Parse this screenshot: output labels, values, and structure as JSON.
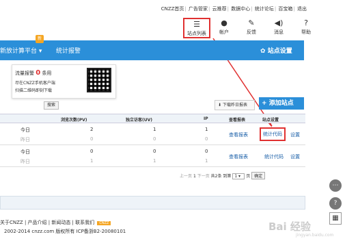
{
  "toplinks": [
    "CNZZ首页",
    "广告管家",
    "云推荐",
    "数据中心",
    "统计论坛",
    "百宝箱",
    "退出"
  ],
  "iconbar": [
    {
      "label": "站点列表",
      "icon": "list-icon"
    },
    {
      "label": "帐户",
      "icon": "user-icon"
    },
    {
      "label": "反馈",
      "icon": "edit-icon"
    },
    {
      "label": "消息",
      "icon": "speaker-icon"
    },
    {
      "label": "帮助",
      "icon": "help-icon"
    }
  ],
  "nav": {
    "platform": "新放计算平台 ▾",
    "report": "统计报警",
    "badge": "新",
    "settings": "站点设置"
  },
  "popup": {
    "line1_prefix": "流量报警",
    "count": "0",
    "line1_suffix": "条用",
    "line2": "尽在CNZZ手机客户端",
    "line3": "扫描二维码即刻下载"
  },
  "toolbar": {
    "search": "搜索",
    "download": "下载昨日报表",
    "add": "添加站点"
  },
  "table": {
    "headers": [
      "浏览次数(PV)",
      "独立访客(UV)",
      "IP",
      "查看报表",
      "站点设置"
    ],
    "rows": [
      {
        "today": "今日",
        "pv": "2",
        "uv": "1",
        "ip": "1",
        "yesterday": "昨日",
        "pv_y": "0",
        "uv_y": "0",
        "ip_y": "0",
        "report": "查看报表",
        "code": "统计代码",
        "settings": "设置"
      },
      {
        "today": "今日",
        "pv": "0",
        "uv": "0",
        "ip": "0",
        "yesterday": "昨日",
        "pv_y": "1",
        "uv_y": "1",
        "ip_y": "1",
        "report": "查看报表",
        "code": "统计代码",
        "settings": "设置"
      }
    ]
  },
  "pager": {
    "prev": "上一页",
    "page": "1",
    "next": "下一页",
    "total": "共2条",
    "goto": "到第",
    "page_sel": "1",
    "unit": "页",
    "ok": "确定"
  },
  "footer": {
    "links": "关于CNZZ | 产品介绍 | 新闻动态 | 联系我们",
    "logo": "CNZZ",
    "copyright": "2002-2014 cnzz.com 版权所有 ICP备浙B2-20080101"
  },
  "watermark": {
    "text": "Bai 经验",
    "sub": "jingyan.baidu.com"
  },
  "colors": {
    "brand": "#2b8fd9",
    "highlight": "#e03030",
    "alert": "#e03030"
  }
}
